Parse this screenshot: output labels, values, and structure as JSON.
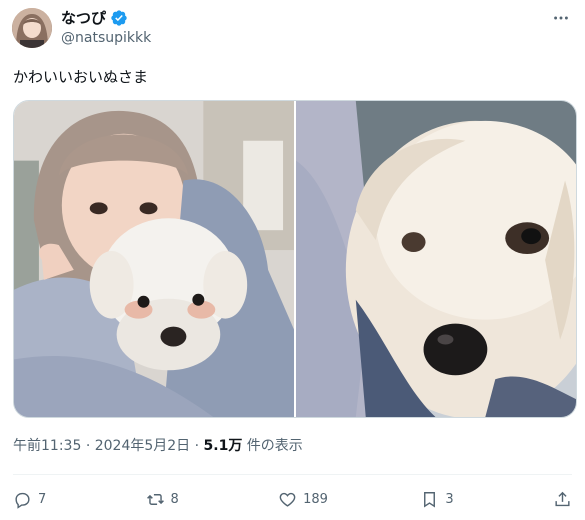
{
  "user": {
    "display_name": "なつぴ",
    "handle": "@natsupikkk",
    "verified_icon": "verified-badge-icon",
    "verified_color": "#1d9bf0"
  },
  "tweet": {
    "text": "かわいいおいぬさま"
  },
  "media": {
    "photo_count": 2
  },
  "meta": {
    "time": "午前11:35",
    "separator": "·",
    "date": "2024年5月2日",
    "views": "5.1万",
    "views_label": "件の表示"
  },
  "actions": {
    "reply_count": "7",
    "retweet_count": "8",
    "like_count": "189",
    "bookmark_count": "3"
  },
  "colors": {
    "text": "#0f1419",
    "secondary": "#536471",
    "accent": "#1d9bf0"
  }
}
